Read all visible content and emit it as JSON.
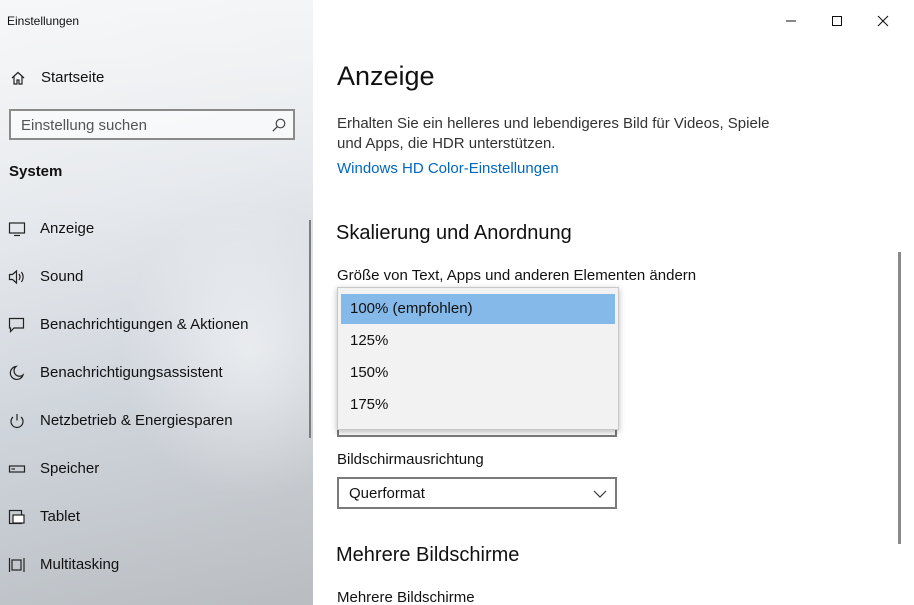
{
  "window": {
    "title": "Einstellungen",
    "controls": [
      "minimize-icon",
      "maximize-icon",
      "close-icon"
    ]
  },
  "sidebar": {
    "home_label": "Startseite",
    "search_placeholder": "Einstellung suchen",
    "section": "System",
    "items": [
      {
        "label": "Anzeige",
        "icon": "monitor-icon"
      },
      {
        "label": "Sound",
        "icon": "speaker-icon"
      },
      {
        "label": "Benachrichtigungen & Aktionen",
        "icon": "notification-icon"
      },
      {
        "label": "Benachrichtigungsassistent",
        "icon": "moon-icon"
      },
      {
        "label": "Netzbetrieb & Energiesparen",
        "icon": "power-icon"
      },
      {
        "label": "Speicher",
        "icon": "storage-icon"
      },
      {
        "label": "Tablet",
        "icon": "tablet-icon"
      },
      {
        "label": "Multitasking",
        "icon": "multitasking-icon"
      }
    ]
  },
  "main": {
    "title": "Anzeige",
    "description": "Erhalten Sie ein helleres und lebendigeres Bild für Videos, Spiele und Apps, die HDR unterstützen.",
    "hd_color_link": "Windows HD Color-Einstellungen",
    "scaling_heading": "Skalierung und Anordnung",
    "scale_label": "Größe von Text, Apps und anderen Elementen ändern",
    "scale_options": [
      "100% (empfohlen)",
      "125%",
      "150%",
      "175%"
    ],
    "scale_selected": "100% (empfohlen)",
    "orientation_label": "Bildschirmausrichtung",
    "orientation_value": "Querformat",
    "multi_heading": "Mehrere Bildschirme",
    "multi_label": "Mehrere Bildschirme"
  },
  "colors": {
    "accent_link": "#0067c0",
    "dropdown_selected": "#84b9e9"
  }
}
